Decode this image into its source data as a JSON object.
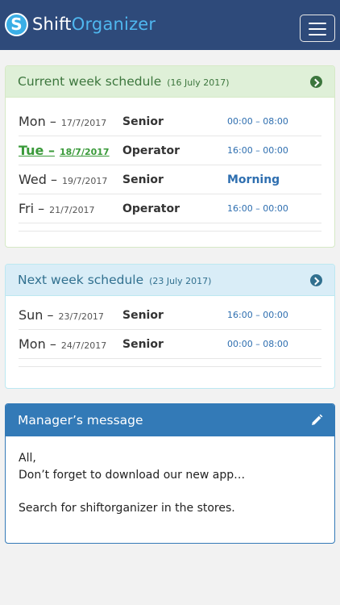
{
  "app": {
    "name_part1": "Shift",
    "name_part2": "Organizer",
    "logo_letter": "S"
  },
  "current_week": {
    "title": "Current week schedule",
    "date": "(16 July 2017)",
    "shifts": [
      {
        "day": "Mon –",
        "date": "17/7/2017",
        "role": "Senior",
        "time": "00:00 – 08:00",
        "today": false,
        "named": false
      },
      {
        "day": "Tue –",
        "date": "18/7/2017",
        "role": "Operator",
        "time": "16:00 – 00:00",
        "today": true,
        "named": false
      },
      {
        "day": "Wed –",
        "date": "19/7/2017",
        "role": "Senior",
        "time": "Morning",
        "today": false,
        "named": true
      },
      {
        "day": "Fri –",
        "date": "21/7/2017",
        "role": "Operator",
        "time": "16:00 – 00:00",
        "today": false,
        "named": false
      }
    ]
  },
  "next_week": {
    "title": "Next week schedule",
    "date": "(23 July 2017)",
    "shifts": [
      {
        "day": "Sun –",
        "date": "23/7/2017",
        "role": "Senior",
        "time": "16:00 – 00:00",
        "today": false,
        "named": false
      },
      {
        "day": "Mon –",
        "date": "24/7/2017",
        "role": "Senior",
        "time": "00:00 – 08:00",
        "today": false,
        "named": false
      }
    ]
  },
  "manager": {
    "title": "Manager’s message",
    "lines": [
      "All,",
      "Don’t forget to download our new app…",
      "",
      "Search for shiftorganizer in the stores."
    ]
  },
  "colors": {
    "navbar": "#2e4a7a",
    "success": "#3c763d",
    "info": "#31708f",
    "primary": "#337ab7"
  }
}
